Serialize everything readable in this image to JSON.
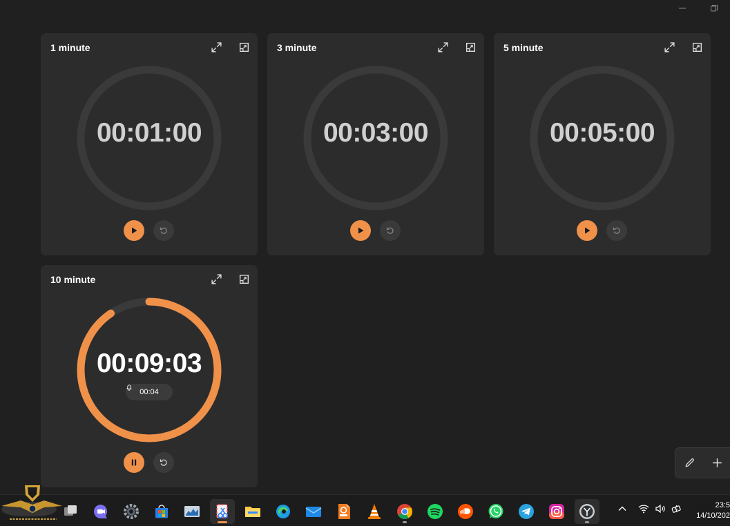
{
  "timers": [
    {
      "title": "1 minute",
      "time": "00:01:00",
      "state": "idle",
      "progress": 1.0
    },
    {
      "title": "3 minute",
      "time": "00:03:00",
      "state": "idle",
      "progress": 1.0
    },
    {
      "title": "5 minute",
      "time": "00:05:00",
      "state": "idle",
      "progress": 1.0
    },
    {
      "title": "10 minute",
      "time": "00:09:03",
      "state": "running",
      "progress": 0.905,
      "alarm": "00:04"
    }
  ],
  "colors": {
    "accent": "#f0914a",
    "card": "#2c2c2c",
    "ring_track": "#3a3a3a",
    "background": "#202020"
  },
  "icons": {
    "expand": "expand-icon",
    "keep_on_top": "keep-on-top-icon",
    "play": "play-icon",
    "pause": "pause-icon",
    "reset": "reset-icon",
    "bell": "bell-icon",
    "edit": "pencil-icon",
    "add": "plus-icon"
  },
  "taskbar": {
    "apps": [
      "task-view",
      "teams",
      "settings",
      "microsoft-store",
      "resource-monitor",
      "snipping-tool",
      "file-explorer",
      "edge",
      "mail",
      "pdf-reader",
      "vlc",
      "chrome",
      "spotify",
      "soundcloud",
      "whatsapp",
      "telegram",
      "instagram",
      "clock"
    ],
    "clock_time": "23:5",
    "clock_date": "14/10/202"
  }
}
